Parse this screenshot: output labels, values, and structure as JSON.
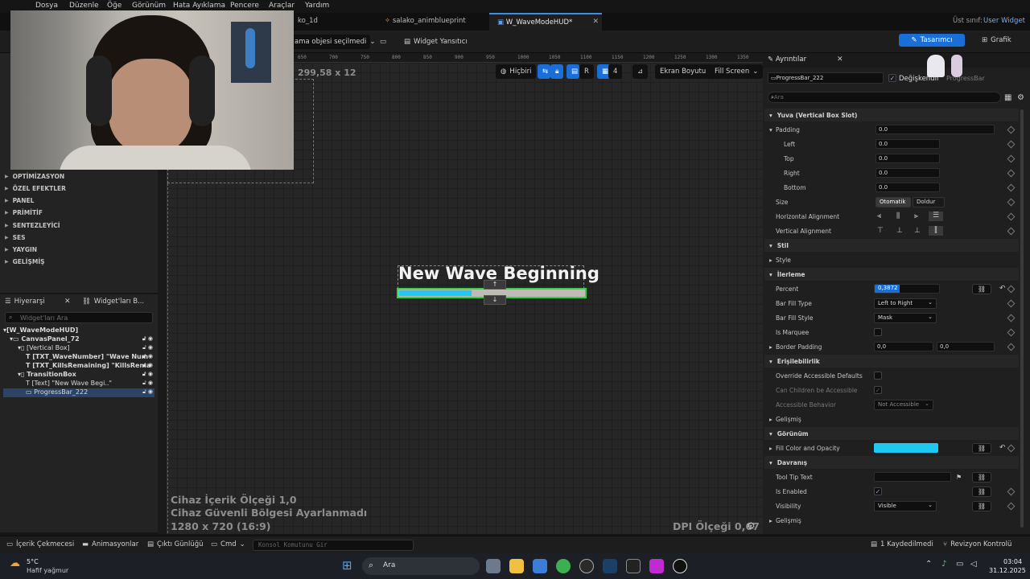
{
  "menu": [
    "Dosya",
    "Düzenle",
    "Öğe",
    "Görünüm",
    "Hata Ayıklama",
    "Pencere",
    "Araçlar",
    "Yardım"
  ],
  "tabs": [
    {
      "label": "ko_1d"
    },
    {
      "label": "salako_animblueprint"
    },
    {
      "label": "W_WaveModeHUD*",
      "active": true
    }
  ],
  "parent_class": {
    "label": "Üst sınıf:",
    "value": "User Widget"
  },
  "toolbar": {
    "debug_object": "ama objesi seçilmedi",
    "widget_reflector": "Widget Yansıtıcı",
    "designer": "Tasarımcı",
    "graph": "Grafik"
  },
  "canvas": {
    "size_readout": "299,58 x 12",
    "none_label": "Hiçbiri",
    "r_label": "R",
    "grid_value": "4",
    "screen_size": "Ekran Boyutu",
    "fill_screen": "Fill Screen",
    "ruler_ticks": [
      "650",
      "700",
      "750",
      "800",
      "850",
      "900",
      "950",
      "1000",
      "1050",
      "1100",
      "1150",
      "1200",
      "1250",
      "1300",
      "1350",
      "1400"
    ],
    "widget_text": "New Wave Beginning",
    "progress_percent": 0.3872,
    "device_scale": "Cihaz İçerik Ölçeği 1,0",
    "safe_zone": "Cihaz Güvenli Bölgesi Ayarlanmadı",
    "resolution": "1280 x 720 (16:9)",
    "dpi_scale": "DPI Ölçeği 0,67"
  },
  "palette": [
    "OPTİMİZASYON",
    "ÖZEL EFEKTLER",
    "PANEL",
    "PRİMİTİF",
    "SENTEZLEYİCİ",
    "SES",
    "YAYGIN",
    "GELİŞMİŞ"
  ],
  "hierarchy": {
    "tab1": "Hiyerarşi",
    "tab2": "Widget'ları B...",
    "search_placeholder": "Widget'ları Ara",
    "rows": [
      "[W_WaveModeHUD]",
      "CanvasPanel_72",
      "[Vertical Box]",
      "[TXT_WaveNumber] \"Wave Num",
      "[TXT_KillsRemaining] \"KillsRema",
      "TransitionBox",
      "[Text] \"New Wave Begi..\"",
      "ProgressBar_222"
    ]
  },
  "details": {
    "title": "Ayrıntılar",
    "widget_name": "ProgressBar_222",
    "is_variable": "Değişkendir",
    "class_label": "ProgressBar",
    "search_placeholder": "Ara",
    "slot_section": "Yuva (Vertical Box Slot)",
    "padding_label": "Padding",
    "padding_value": "0.0",
    "left_label": "Left",
    "left_value": "0.0",
    "top_label": "Top",
    "top_value": "0.0",
    "right_label": "Right",
    "right_value": "0.0",
    "bottom_label": "Bottom",
    "bottom_value": "0.0",
    "size_label": "Size",
    "size_auto": "Otomatik",
    "size_fill": "Doldur",
    "halign_label": "Horizontal Alignment",
    "valign_label": "Vertical Alignment",
    "style_section": "Stil",
    "style_label": "Style",
    "progress_section": "İlerleme",
    "percent_label": "Percent",
    "percent_value": "0,3872",
    "fill_type_label": "Bar Fill Type",
    "fill_type_value": "Left to Right",
    "fill_style_label": "Bar Fill Style",
    "fill_style_value": "Mask",
    "marquee_label": "Is Marquee",
    "border_padding_label": "Border Padding",
    "border_padding_x": "0,0",
    "border_padding_y": "0,0",
    "access_section": "Erişilebilirlik",
    "override_label": "Override Accessible Defaults",
    "children_label": "Can Children be Accessible",
    "behavior_label": "Accessible Behavior",
    "behavior_value": "Not Accessible",
    "advanced_label": "Gelişmiş",
    "appearance_section": "Görünüm",
    "fill_color_label": "Fill Color and Opacity",
    "fill_color": "#1ec8f0",
    "behavior_section": "Davranış",
    "tooltip_label": "Tool Tip Text",
    "enabled_label": "Is Enabled",
    "visibility_label": "Visibility",
    "visibility_value": "Visible",
    "advanced2_label": "Gelişmiş"
  },
  "bottombar": {
    "content_drawer": "İçerik Çekmecesi",
    "animations": "Animasyonlar",
    "output_log": "Çıktı Günlüğü",
    "cmd": "Cmd",
    "console_placeholder": "Konsol Komutunu Gir",
    "unsaved": "1 Kaydedilmedi",
    "revision": "Revizyon Kontrolü"
  },
  "taskbar": {
    "temp": "5°C",
    "weather": "Hafif yağmur",
    "search": "Ara",
    "time": "03:04",
    "date": "31.12.2025"
  },
  "colors": {
    "accent": "#1a6ed8",
    "progress_fill": "#1ec8f0",
    "selection_outline": "#35d04a"
  }
}
